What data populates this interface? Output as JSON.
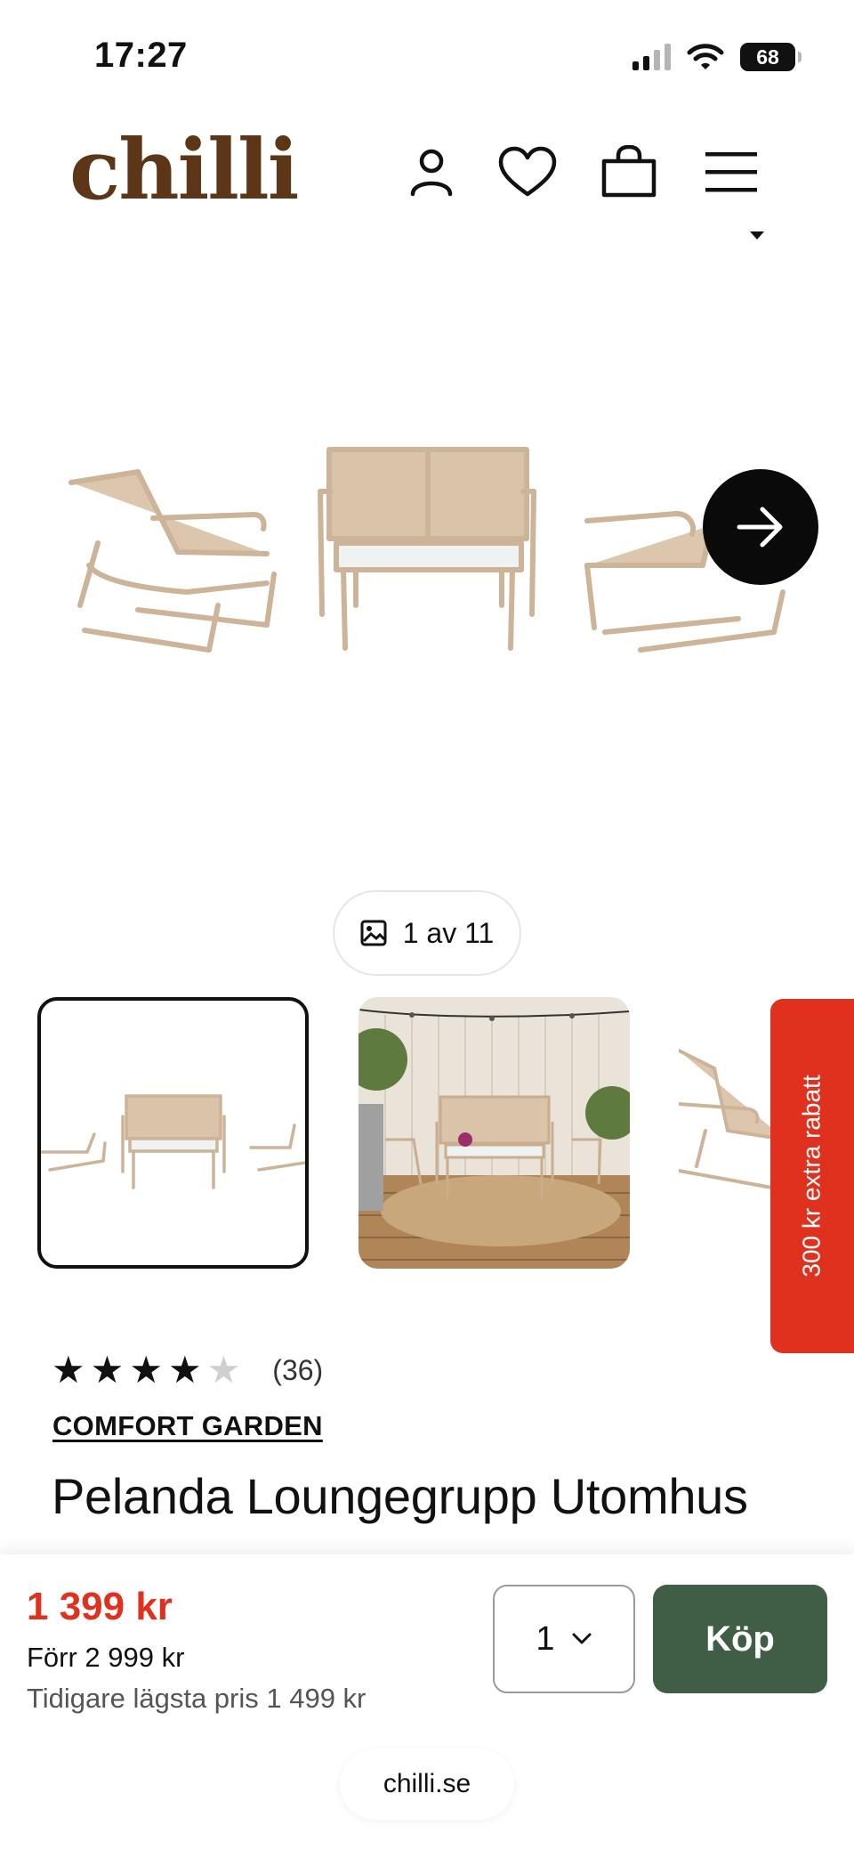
{
  "status_bar": {
    "time": "17:27",
    "battery": "68",
    "icons": [
      "cellular-signal-icon",
      "wifi-icon",
      "battery-icon"
    ]
  },
  "header": {
    "logo": "chilli",
    "logo_color": "#5c3616",
    "icons": [
      "account-icon",
      "heart-icon",
      "shopping-bag-icon",
      "menu-icon"
    ]
  },
  "gallery": {
    "counter": "1 av 11",
    "thumbnails": [
      "lounge-set-white-background",
      "lounge-set-patio-scene",
      "lounge-chair-closeup"
    ],
    "selected_index": 0,
    "next_icon": "arrow-right-icon"
  },
  "promo": {
    "label": "300 kr extra rabatt",
    "color": "#e0301e"
  },
  "product": {
    "rating": 4,
    "rating_max": 5,
    "review_count": "(36)",
    "brand": "COMFORT GARDEN",
    "title": "Pelanda Loungegrupp Utomhus"
  },
  "purchase": {
    "price": "1 399 kr",
    "price_before": "Förr 2 999 kr",
    "lowest_price": "Tidigare lägsta pris 1 499 kr",
    "quantity": "1",
    "buy_label": "Köp",
    "buy_color": "#3f5e45"
  },
  "browser": {
    "url": "chilli.se"
  }
}
